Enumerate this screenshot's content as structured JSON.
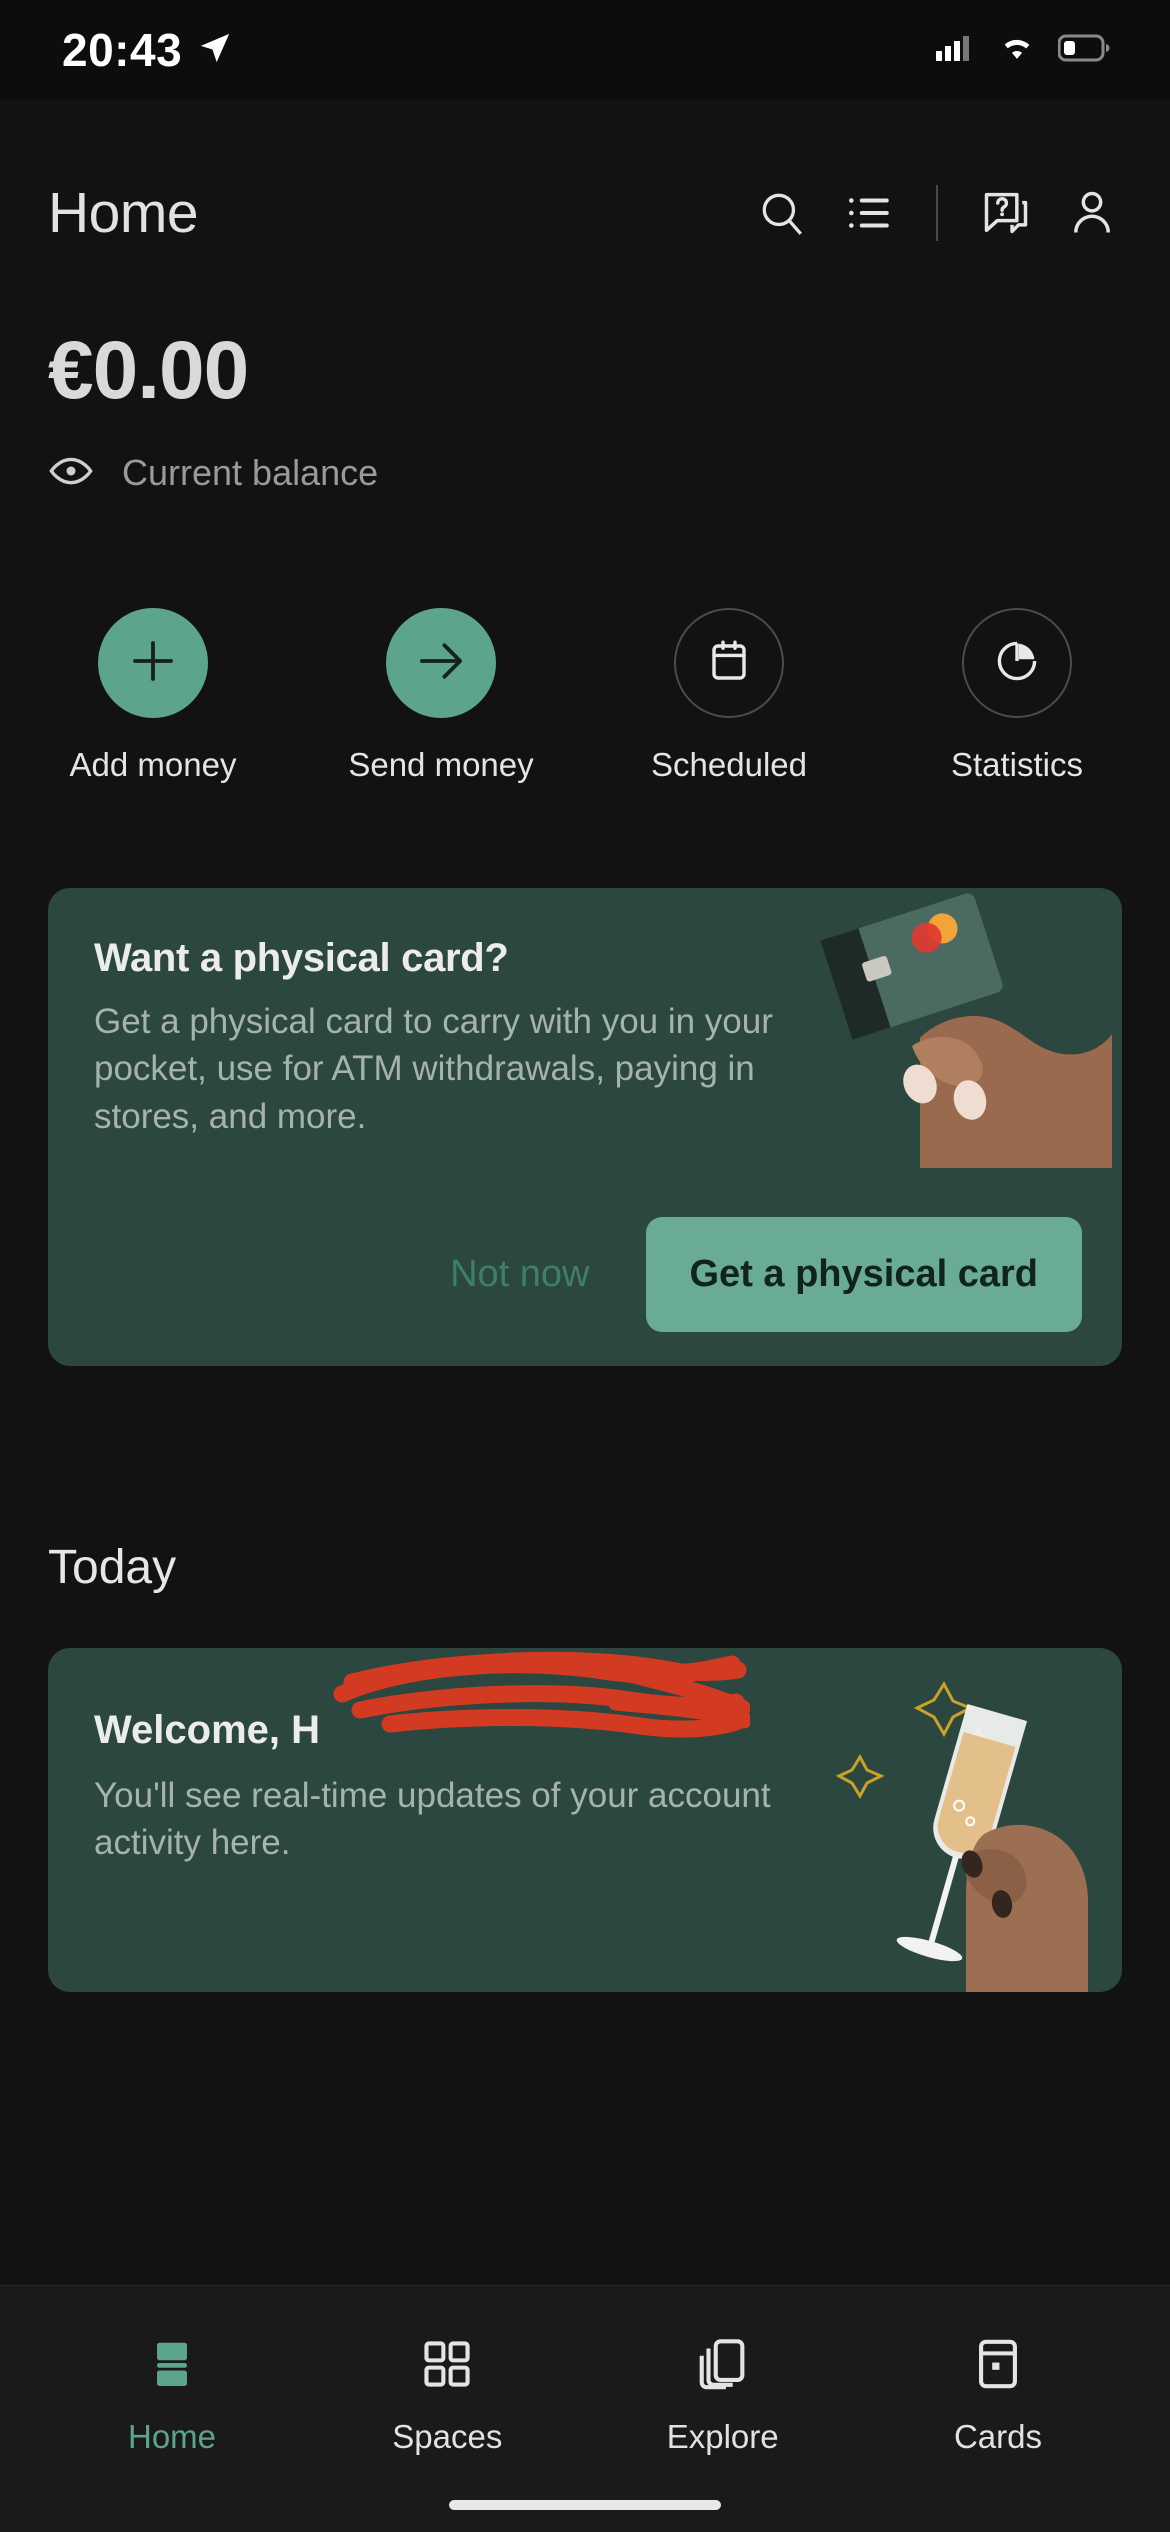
{
  "statusbar": {
    "time": "20:43",
    "location_icon": "location-arrow-icon",
    "cellular_icon": "cellular-signal-icon",
    "wifi_icon": "wifi-icon",
    "battery_icon": "battery-low-icon"
  },
  "header": {
    "title": "Home",
    "icons": [
      {
        "name": "search-icon"
      },
      {
        "name": "list-icon"
      },
      {
        "name": "help-chat-icon"
      },
      {
        "name": "profile-icon"
      }
    ]
  },
  "balance": {
    "amount": "€0.00",
    "label": "Current balance",
    "eye_icon": "eye-icon"
  },
  "quick_actions": [
    {
      "label": "Add money",
      "icon": "plus-icon",
      "style": "filled"
    },
    {
      "label": "Send money",
      "icon": "arrow-right-icon",
      "style": "filled"
    },
    {
      "label": "Scheduled",
      "icon": "calendar-icon",
      "style": "outline"
    },
    {
      "label": "Statistics",
      "icon": "pie-chart-icon",
      "style": "outline"
    }
  ],
  "promo_card": {
    "title": "Want a physical card?",
    "body": "Get a physical card to carry with you in your pocket, use for ATM withdrawals, paying in stores, and more.",
    "secondary_button": "Not now",
    "primary_button": "Get a physical card",
    "illustration": "hand-holding-card-image"
  },
  "today": {
    "section_title": "Today",
    "welcome_title": "Welcome, H",
    "welcome_body": "You'll see real-time updates of your account activity here.",
    "illustration": "hand-holding-champagne-glass-image",
    "redaction": "red-scribble-redaction"
  },
  "bottom_nav": [
    {
      "label": "Home",
      "icon": "home-bars-icon",
      "active": true
    },
    {
      "label": "Spaces",
      "icon": "grid-squares-icon",
      "active": false
    },
    {
      "label": "Explore",
      "icon": "stacked-cards-icon",
      "active": false
    },
    {
      "label": "Cards",
      "icon": "card-icon",
      "active": false
    }
  ],
  "colors": {
    "accent_teal": "#5ca48c",
    "card_green": "#2b4740",
    "button_teal": "#69ab94",
    "background": "#121212",
    "redaction_red": "#d93a22"
  }
}
